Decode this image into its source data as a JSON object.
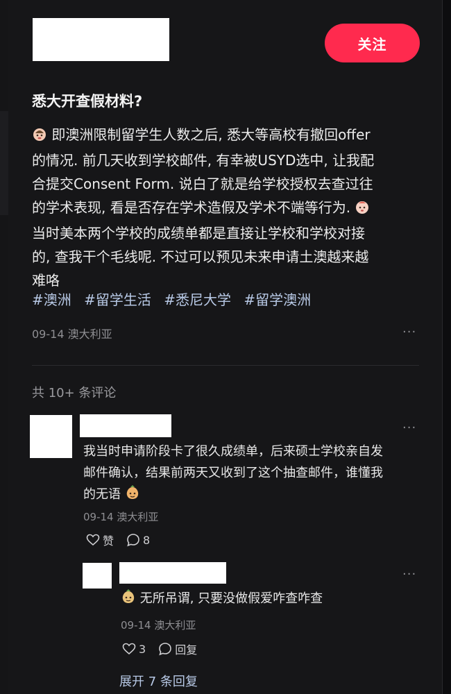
{
  "post": {
    "follow_label": "关注",
    "title": "悉大开查假材料?",
    "body_lines": [
      "即澳洲限制留学生人数之后, 悉大等高校有撤回offer",
      "的情况. 前几天收到学校邮件, 有幸被USYD选中, 让我配",
      "合提交Consent Form. 说白了就是给学校授权去查过往",
      "的学术表现, 看是否存在学术造假及学术不端等行为.",
      "当时美本两个学校的成绩单都是直接让学校和学校对接",
      "的, 查我干个毛线呢. 不过可以预见未来申请土澳越来越",
      "难咯"
    ],
    "hashtags": [
      "#澳洲",
      "#留学生活",
      "#悉尼大学",
      "#留学澳洲"
    ],
    "date": "09-14",
    "location": "澳大利亚"
  },
  "comments_header": "共 10+ 条评论",
  "comment": {
    "text_lines": [
      "我当时申请阶段卡了很久成绩单，后来硕士学校亲自发",
      "邮件确认，结果前两天又收到了这个抽查邮件，谁懂我",
      "的无语"
    ],
    "date": "09-14",
    "location": "澳大利亚",
    "like_label": "赞",
    "reply_count": "8"
  },
  "reply": {
    "text": "无所吊谓, 只要没做假爱咋查咋查",
    "date": "09-14",
    "location": "澳大利亚",
    "like_count": "3",
    "reply_label": "回复"
  },
  "expand_label": "展开 7 条回复",
  "more_label": "···"
}
